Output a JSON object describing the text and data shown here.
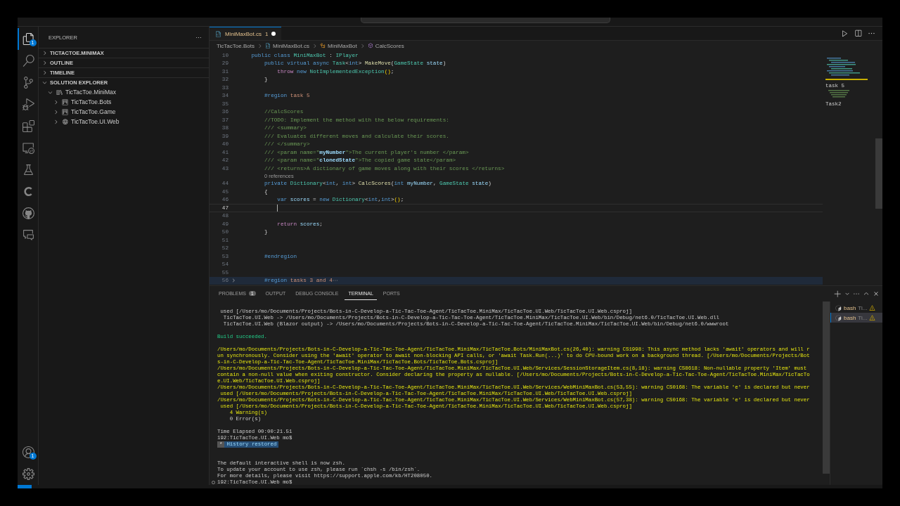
{
  "activity_bar": {
    "items": [
      {
        "kind": "files",
        "selected": true,
        "badge": "1"
      },
      {
        "kind": "search",
        "selected": false
      },
      {
        "kind": "source-control",
        "selected": false
      },
      {
        "kind": "run-debug",
        "selected": false
      },
      {
        "kind": "extensions",
        "selected": false
      },
      {
        "kind": "remote",
        "selected": false
      },
      {
        "kind": "testing",
        "selected": false
      },
      {
        "kind": "c-extension",
        "selected": false
      },
      {
        "kind": "github",
        "selected": false
      },
      {
        "kind": "chat",
        "selected": false
      }
    ],
    "bottom": [
      {
        "kind": "account",
        "selected": false,
        "badge": "1"
      },
      {
        "kind": "settings",
        "selected": false
      }
    ]
  },
  "sidebar": {
    "title": "EXPLORER",
    "sections": [
      {
        "label": "TICTACTOE.MINIMAX",
        "expanded": false
      },
      {
        "label": "OUTLINE",
        "expanded": false
      },
      {
        "label": "TIMELINE",
        "expanded": false
      },
      {
        "label": "SOLUTION EXPLORER",
        "expanded": true,
        "children": [
          {
            "label": "TicTacToe.MiniMax",
            "kind": "solution",
            "expanded": true,
            "children": [
              {
                "label": "TicTacToe.Bots",
                "kind": "project",
                "expanded": false
              },
              {
                "label": "TicTacToe.Game",
                "kind": "project",
                "expanded": false
              },
              {
                "label": "TicTacToe.UI.Web",
                "kind": "web",
                "expanded": false
              }
            ]
          }
        ]
      }
    ]
  },
  "tabs": [
    {
      "label": "MiniMaxBot.cs",
      "problems": "1",
      "modified": true,
      "selected": true
    }
  ],
  "breadcrumbs": [
    {
      "label": "TicTacToe.Bots",
      "kind": "folder"
    },
    {
      "label": "MiniMaxBot.cs",
      "kind": "file"
    },
    {
      "label": "MiniMaxBot",
      "kind": "class"
    },
    {
      "label": "CalcScores",
      "kind": "method"
    }
  ],
  "editor": {
    "lines": [
      {
        "number": "10",
        "tokens": [
          {
            "text": "    public class ",
            "kind": "kw"
          },
          {
            "text": "MiniMaxBot",
            "kind": "type"
          },
          {
            "text": " : ",
            "kind": "plain"
          },
          {
            "text": "IPlayer",
            "kind": "type"
          }
        ]
      },
      {
        "number": "29",
        "tokens": [
          {
            "text": "        public virtual async ",
            "kind": "kw"
          },
          {
            "text": "Task",
            "kind": "type"
          },
          {
            "text": "<",
            "kind": "plain"
          },
          {
            "text": "int",
            "kind": "kw"
          },
          {
            "text": "> ",
            "kind": "plain"
          },
          {
            "text": "MakeMove",
            "kind": "fn"
          },
          {
            "text": "(",
            "kind": "plain"
          },
          {
            "text": "GameState",
            "kind": "type"
          },
          {
            "text": " state",
            "kind": "var"
          },
          {
            "text": ")",
            "kind": "plain"
          }
        ]
      },
      {
        "number": "31",
        "tokens": [
          {
            "text": "            throw",
            "kind": "ctrl"
          },
          {
            "text": " new ",
            "kind": "kw"
          },
          {
            "text": "NotImplementedException",
            "kind": "type"
          },
          {
            "text": "()",
            "kind": "punct"
          },
          {
            "text": ";",
            "kind": "plain"
          }
        ]
      },
      {
        "number": "32",
        "tokens": [
          {
            "text": "        }",
            "kind": "plain"
          }
        ]
      },
      {
        "number": "33"
      },
      {
        "number": "34",
        "tokens": [
          {
            "text": "        #region",
            "kind": "region"
          },
          {
            "text": " task 5",
            "kind": "regionname"
          }
        ]
      },
      {
        "number": "35"
      },
      {
        "number": "36",
        "tokens": [
          {
            "text": "        //CalcScores",
            "kind": "comment"
          }
        ]
      },
      {
        "number": "37",
        "tokens": [
          {
            "text": "        //TODO: Implement the method with the below requirements:",
            "kind": "comment"
          }
        ]
      },
      {
        "number": "38",
        "tokens": [
          {
            "text": "        /// <summary>",
            "kind": "doc"
          }
        ]
      },
      {
        "number": "39",
        "tokens": [
          {
            "text": "        /// Evaluates different moves and calculate their scores.",
            "kind": "doc"
          }
        ]
      },
      {
        "number": "40",
        "tokens": [
          {
            "text": "        /// </summary>",
            "kind": "doc"
          }
        ]
      },
      {
        "number": "41",
        "tokens": [
          {
            "text": "        /// <param name=\"",
            "kind": "doc"
          },
          {
            "text": "myNumber",
            "kind": "docname"
          },
          {
            "text": "\">The current player's number </param>",
            "kind": "doc"
          }
        ]
      },
      {
        "number": "42",
        "tokens": [
          {
            "text": "        /// <param name=\"",
            "kind": "doc"
          },
          {
            "text": "clonedState",
            "kind": "docname"
          },
          {
            "text": "\">The copied game state</param>",
            "kind": "doc"
          }
        ]
      },
      {
        "number": "43",
        "tokens": [
          {
            "text": "        /// <returns>A dictionary of game moves along with their scores </returns>",
            "kind": "doc"
          }
        ]
      },
      {
        "kind": "codelens",
        "text": "0 references"
      },
      {
        "number": "44",
        "tokens": [
          {
            "text": "        private",
            "kind": "kw"
          },
          {
            "text": " Dictionary",
            "kind": "type"
          },
          {
            "text": "<",
            "kind": "plain"
          },
          {
            "text": "int",
            "kind": "kw"
          },
          {
            "text": ", ",
            "kind": "plain"
          },
          {
            "text": "int",
            "kind": "kw"
          },
          {
            "text": "> ",
            "kind": "plain"
          },
          {
            "text": "CalcScores",
            "kind": "fn"
          },
          {
            "text": "(",
            "kind": "plain"
          },
          {
            "text": "int",
            "kind": "kw"
          },
          {
            "text": " myNumber",
            "kind": "var"
          },
          {
            "text": ", ",
            "kind": "plain"
          },
          {
            "text": "GameState",
            "kind": "type"
          },
          {
            "text": " state",
            "kind": "var"
          },
          {
            "text": ")",
            "kind": "plain"
          }
        ]
      },
      {
        "number": "45",
        "tokens": [
          {
            "text": "        {",
            "kind": "plain"
          }
        ]
      },
      {
        "number": "46",
        "tokens": [
          {
            "text": "            var",
            "kind": "kw"
          },
          {
            "text": " scores",
            "kind": "var"
          },
          {
            "text": " = ",
            "kind": "plain"
          },
          {
            "text": "new",
            "kind": "kw"
          },
          {
            "text": " Dictionary",
            "kind": "type"
          },
          {
            "text": "<",
            "kind": "plain"
          },
          {
            "text": "int",
            "kind": "kw"
          },
          {
            "text": ",",
            "kind": "plain"
          },
          {
            "text": "int",
            "kind": "kw"
          },
          {
            "text": ">",
            "kind": "plain"
          },
          {
            "text": "()",
            "kind": "punct"
          },
          {
            "text": ";",
            "kind": "plain"
          }
        ]
      },
      {
        "number": "47",
        "current": true
      },
      {
        "number": "48"
      },
      {
        "number": "49",
        "tokens": [
          {
            "text": "            return",
            "kind": "ctrl"
          },
          {
            "text": " scores",
            "kind": "var"
          },
          {
            "text": ";",
            "kind": "plain"
          }
        ]
      },
      {
        "number": "50",
        "tokens": [
          {
            "text": "        }",
            "kind": "plain"
          }
        ]
      },
      {
        "number": "51"
      },
      {
        "number": "52"
      },
      {
        "number": "53",
        "tokens": [
          {
            "text": "        #endregion",
            "kind": "region"
          }
        ]
      },
      {
        "number": "54"
      },
      {
        "number": "55"
      },
      {
        "number": "56",
        "tokens": [
          {
            "text": "        #region",
            "kind": "region"
          },
          {
            "text": " tasks 3 and 4",
            "kind": "regionname"
          }
        ],
        "folded": true
      }
    ],
    "minimap_labels": [
      "task 5",
      "Task2"
    ]
  },
  "panel": {
    "tabs": [
      {
        "label": "PROBLEMS",
        "badge": "1",
        "selected": false
      },
      {
        "label": "OUTPUT",
        "selected": false
      },
      {
        "label": "DEBUG CONSOLE",
        "selected": false
      },
      {
        "label": "TERMINAL",
        "selected": true
      },
      {
        "label": "PORTS",
        "selected": false
      }
    ],
    "terminal_lines": [
      {
        "kind": "plain",
        "text": " used [/Users/mo/Documents/Projects/Bots-in-C-Develop-a-Tic-Tac-Toe-Agent/TicTacToe.MiniMax/TicTacToe.UI.Web/TicTacToe.UI.Web.csproj]"
      },
      {
        "kind": "plain",
        "text": "  TicTacToe.UI.Web -> /Users/mo/Documents/Projects/Bots-in-C-Develop-a-Tic-Tac-Toe-Agent/TicTacToe.MiniMax/TicTacToe.UI.Web/bin/Debug/net6.0/TicTacToe.UI.Web.dll"
      },
      {
        "kind": "plain",
        "text": "  TicTacToe.UI.Web (Blazor output) -> /Users/mo/Documents/Projects/Bots-in-C-Develop-a-Tic-Tac-Toe-Agent/TicTacToe.MiniMax/TicTacToe.UI.Web/bin/Debug/net6.0/wwwroot"
      },
      {
        "kind": "blank"
      },
      {
        "kind": "success",
        "text": "Build succeeded."
      },
      {
        "kind": "blank"
      },
      {
        "kind": "warning",
        "text": "/Users/mo/Documents/Projects/Bots-in-C-Develop-a-Tic-Tac-Toe-Agent/TicTacToe.MiniMax/TicTacToe.Bots/MiniMaxBot.cs(26,40): warning CS1998: This async method lacks 'await' operators and will r"
      },
      {
        "kind": "warning",
        "text": "un synchronously. Consider using the 'await' operator to await non-blocking API calls, or 'await Task.Run(...)' to do CPU-bound work on a background thread. [/Users/mo/Documents/Projects/Bot"
      },
      {
        "kind": "warning",
        "text": "s-in-C-Develop-a-Tic-Tac-Toe-Agent/TicTacToe.MiniMax/TicTacToe.Bots/TicTacToe.Bots.csproj]"
      },
      {
        "kind": "warning",
        "text": "/Users/mo/Documents/Projects/Bots-in-C-Develop-a-Tic-Tac-Toe-Agent/TicTacToe.MiniMax/TicTacToe.UI.Web/Services/SessionStorageItem.cs(8,18): warning CS8618: Non-nullable property 'Item' must"
      },
      {
        "kind": "warning",
        "text": "contain a non-null value when exiting constructor. Consider declaring the property as nullable. [/Users/mo/Documents/Projects/Bots-in-C-Develop-a-Tic-Tac-Toe-Agent/TicTacToe.MiniMax/TicTacTo"
      },
      {
        "kind": "warning",
        "text": "e.UI.Web/TicTacToe.UI.Web.csproj]"
      },
      {
        "kind": "warning",
        "text": "/Users/mo/Documents/Projects/Bots-in-C-Develop-a-Tic-Tac-Toe-Agent/TicTacToe.MiniMax/TicTacToe.UI.Web/Services/WebMiniMaxBot.cs(53,55): warning CS0168: The variable 'e' is declared but never"
      },
      {
        "kind": "warning",
        "text": " used [/Users/mo/Documents/Projects/Bots-in-C-Develop-a-Tic-Tac-Toe-Agent/TicTacToe.MiniMax/TicTacToe.UI.Web/TicTacToe.UI.Web.csproj]"
      },
      {
        "kind": "warning",
        "text": "/Users/mo/Documents/Projects/Bots-in-C-Develop-a-Tic-Tac-Toe-Agent/TicTacToe.MiniMax/TicTacToe.UI.Web/Services/WebMiniMaxBot.cs(57,38): warning CS0168: The variable 'e' is declared but never"
      },
      {
        "kind": "warning",
        "text": " used [/Users/mo/Documents/Projects/Bots-in-C-Develop-a-Tic-Tac-Toe-Agent/TicTacToe.MiniMax/TicTacToe.UI.Web/TicTacToe.UI.Web.csproj]"
      },
      {
        "kind": "warning",
        "text": "    4 Warning(s)"
      },
      {
        "kind": "plain",
        "text": "    0 Error(s)"
      },
      {
        "kind": "blank"
      },
      {
        "kind": "plain",
        "text": "Time Elapsed 00:00:21.51"
      },
      {
        "kind": "plain",
        "text": "192:TicTacToe.UI.Web mo$"
      },
      {
        "kind": "restored",
        "marker": "*",
        "text": "History restored"
      },
      {
        "kind": "blank"
      },
      {
        "kind": "blank"
      },
      {
        "kind": "plain",
        "text": "The default interactive shell is now zsh."
      },
      {
        "kind": "plain",
        "text": "To update your account to use zsh, please run `chsh -s /bin/zsh`."
      },
      {
        "kind": "plain",
        "text": "For more details, please visit https://support.apple.com/kb/HT208050."
      },
      {
        "kind": "prompt",
        "text": "192:TicTacToe.UI.Web mo$"
      }
    ],
    "terminals": [
      {
        "name": "bash",
        "detail": "Ti...",
        "selected": false
      },
      {
        "name": "bash",
        "detail": "Ti...",
        "selected": true
      }
    ]
  }
}
